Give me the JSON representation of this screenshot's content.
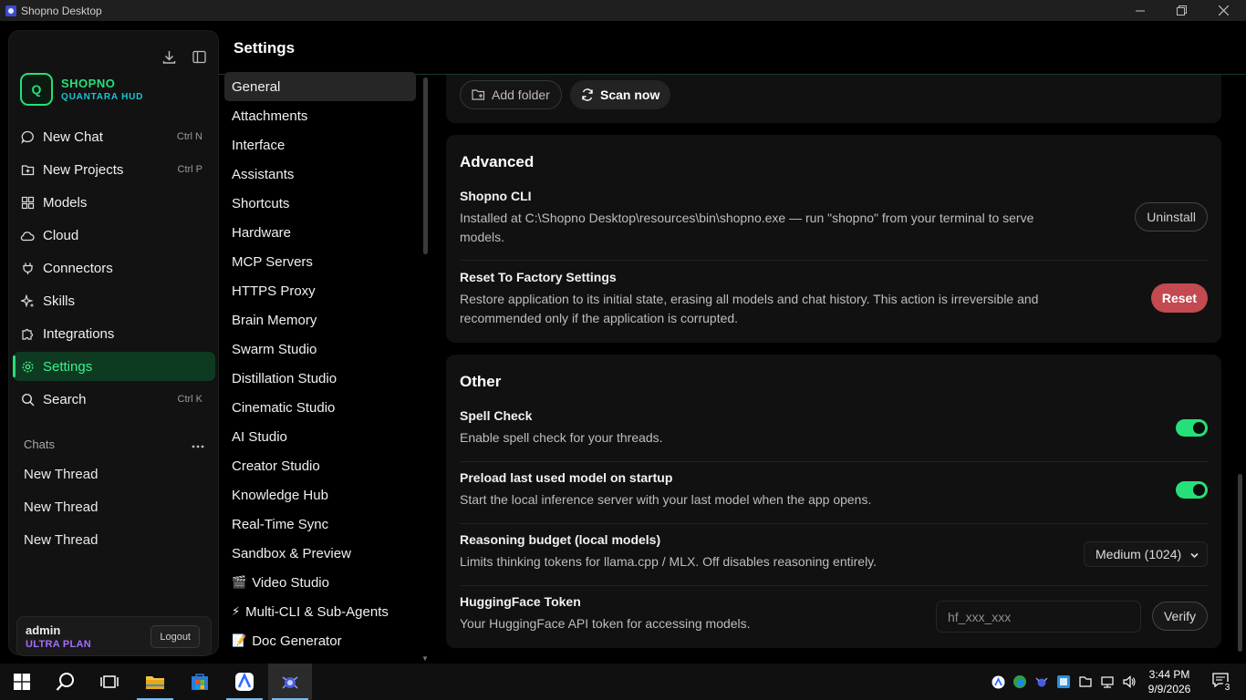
{
  "window": {
    "title": "Shopno Desktop"
  },
  "sidebar": {
    "brand_logo": "Q",
    "brand_name": "SHOPNO",
    "brand_sub": "QUANTARA HUD",
    "nav": [
      {
        "label": "New Chat",
        "kbd": "Ctrl  N",
        "icon": "chat-bubble-icon"
      },
      {
        "label": "New Projects",
        "kbd": "Ctrl  P",
        "icon": "folder-plus-icon"
      },
      {
        "label": "Models",
        "kbd": "",
        "icon": "grid-blocks-icon"
      },
      {
        "label": "Cloud",
        "kbd": "",
        "icon": "cloud-icon"
      },
      {
        "label": "Connectors",
        "kbd": "",
        "icon": "plug-icon"
      },
      {
        "label": "Skills",
        "kbd": "",
        "icon": "sparkles-icon"
      },
      {
        "label": "Integrations",
        "kbd": "",
        "icon": "puzzle-icon"
      },
      {
        "label": "Settings",
        "kbd": "",
        "icon": "gear-icon"
      },
      {
        "label": "Search",
        "kbd": "Ctrl  K",
        "icon": "search-icon"
      }
    ],
    "chats_label": "Chats",
    "threads": [
      "New Thread",
      "New Thread",
      "New Thread"
    ],
    "user": {
      "name": "admin",
      "plan": "ULTRA PLAN",
      "logout": "Logout"
    }
  },
  "header": {
    "title": "Settings"
  },
  "categories": [
    {
      "label": "General",
      "emoji": ""
    },
    {
      "label": "Attachments",
      "emoji": ""
    },
    {
      "label": "Interface",
      "emoji": ""
    },
    {
      "label": "Assistants",
      "emoji": ""
    },
    {
      "label": "Shortcuts",
      "emoji": ""
    },
    {
      "label": "Hardware",
      "emoji": ""
    },
    {
      "label": "MCP Servers",
      "emoji": ""
    },
    {
      "label": "HTTPS Proxy",
      "emoji": ""
    },
    {
      "label": "Brain Memory",
      "emoji": ""
    },
    {
      "label": "Swarm Studio",
      "emoji": ""
    },
    {
      "label": "Distillation Studio",
      "emoji": ""
    },
    {
      "label": "Cinematic Studio",
      "emoji": ""
    },
    {
      "label": "AI Studio",
      "emoji": ""
    },
    {
      "label": "Creator Studio",
      "emoji": ""
    },
    {
      "label": "Knowledge Hub",
      "emoji": ""
    },
    {
      "label": "Real-Time Sync",
      "emoji": ""
    },
    {
      "label": "Sandbox & Preview",
      "emoji": ""
    },
    {
      "label": "Video Studio",
      "emoji": "🎬"
    },
    {
      "label": "Multi-CLI & Sub-Agents",
      "emoji": "⚡"
    },
    {
      "label": "Doc Generator",
      "emoji": "📝"
    }
  ],
  "folders": {
    "add_folder": "Add folder",
    "scan_now": "Scan now"
  },
  "advanced": {
    "title": "Advanced",
    "cli_title": "Shopno CLI",
    "cli_desc": "Installed at C:\\Shopno Desktop\\resources\\bin\\shopno.exe — run \"shopno\" from your terminal to serve models.",
    "cli_button": "Uninstall",
    "reset_title": "Reset To Factory Settings",
    "reset_desc": "Restore application to its initial state, erasing all models and chat history. This action is irreversible and recommended only if the application is corrupted.",
    "reset_button": "Reset"
  },
  "other": {
    "title": "Other",
    "spell_title": "Spell Check",
    "spell_desc": "Enable spell check for your threads.",
    "spell_on": true,
    "preload_title": "Preload last used model on startup",
    "preload_desc": "Start the local inference server with your last model when the app opens.",
    "preload_on": true,
    "reasoning_title": "Reasoning budget (local models)",
    "reasoning_desc": "Limits thinking tokens for llama.cpp / MLX. Off disables reasoning entirely.",
    "reasoning_value": "Medium (1024)",
    "hf_title": "HuggingFace Token",
    "hf_desc": "Your HuggingFace API token for accessing models.",
    "hf_placeholder": "hf_xxx_xxx",
    "hf_button": "Verify"
  },
  "taskbar": {
    "time": "3:44 PM",
    "date": "9/9/2026",
    "notifications": "3"
  },
  "colors": {
    "accent": "#25e07a",
    "reset": "#c24a50",
    "plan": "#a56cff",
    "brand_sub": "#19c4d6"
  }
}
